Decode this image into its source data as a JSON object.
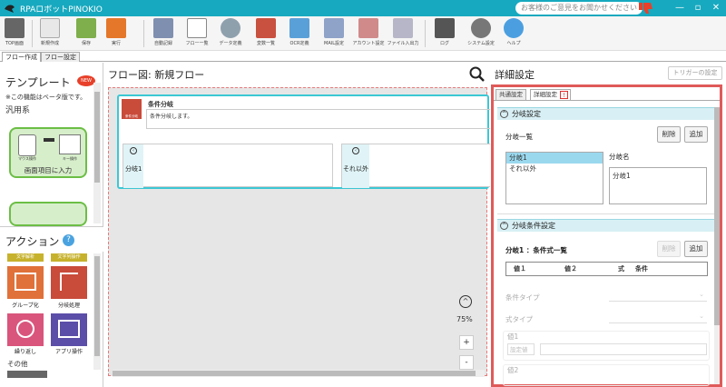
{
  "app": {
    "title": "RPAロボットPINOKIO",
    "feedback": "お客様のご意見をお聞かせください",
    "minimize": "—",
    "restore": "▫",
    "close": "✕"
  },
  "toolbar": [
    {
      "label": "TOP画面",
      "color": "#666666"
    },
    {
      "label": "新規作成",
      "color": "#dddddd"
    },
    {
      "label": "保存",
      "color": "#7fae4c"
    },
    {
      "label": "実行",
      "color": "#e5772a"
    },
    {
      "label": "自動記録",
      "color": "#7f8fb0"
    },
    {
      "label": "フロー一覧",
      "color": "#888888"
    },
    {
      "label": "データ定義",
      "color": "#8fa0ad"
    },
    {
      "label": "変数一覧",
      "color": "#c9513f"
    },
    {
      "label": "OCR定義",
      "color": "#5aa0d8"
    },
    {
      "label": "MAIL設定",
      "color": "#8fa2c8"
    },
    {
      "label": "アカウント設定",
      "color": "#d08a8a"
    },
    {
      "label": "ファイル入出力",
      "color": "#b6b6c8"
    },
    {
      "label": "ログ",
      "color": "#555555"
    },
    {
      "label": "システム設定",
      "color": "#777777"
    },
    {
      "label": "ヘルプ",
      "color": "#4b9fe0"
    }
  ],
  "tabs": {
    "flow_create": "フロー作成",
    "flow_settings": "フロー設定"
  },
  "left": {
    "template_title": "テンプレート",
    "new_badge": "NEW",
    "beta_note": "※この機能はベータ版です。",
    "category": "汎用系",
    "template_card": "画面項目に入力",
    "mouse_label": "マウス操作",
    "key_label": "キー操作",
    "action_title": "アクション",
    "help": "?",
    "yellow_left": "文字解析",
    "yellow_right": "文字列操作",
    "actions": [
      {
        "label": "グループ化",
        "color": "#e0713a"
      },
      {
        "label": "分岐処理",
        "color": "#c94b3a"
      },
      {
        "label": "繰り返し",
        "color": "#d9557c"
      },
      {
        "label": "アプリ操作",
        "color": "#5b4ea8"
      }
    ],
    "other": "その他"
  },
  "canvas": {
    "title": "フロー図:  新規フロー",
    "node_title": "条件分岐",
    "node_icon_label": "条件分岐",
    "node_desc": "条件分岐します。",
    "branch1": "分岐1",
    "branch2": "それ以外",
    "zoom": "75%",
    "zoom_in": "+",
    "zoom_out": "-"
  },
  "right": {
    "title": "詳細設定",
    "trigger": "トリガーの設定",
    "tab_common": "共通設定",
    "tab_detail": "詳細設定",
    "warn": "!",
    "branch_settings": "分岐設定",
    "branch_list": "分岐一覧",
    "delete": "削除",
    "add": "追加",
    "branch_items": [
      "分岐1",
      "それ以外"
    ],
    "branch_name_label": "分岐名",
    "branch_name_value": "分岐1",
    "cond_settings": "分岐条件設定",
    "cond_list": "分岐1  ：条件式一覧",
    "col_v1": "値１",
    "col_v2": "値２",
    "col_expr": "式",
    "col_cond": "条件",
    "cond_type": "条件タイプ",
    "expr_type": "式タイプ",
    "value1": "値1",
    "setting_value": "設定値",
    "value2": "値2"
  }
}
